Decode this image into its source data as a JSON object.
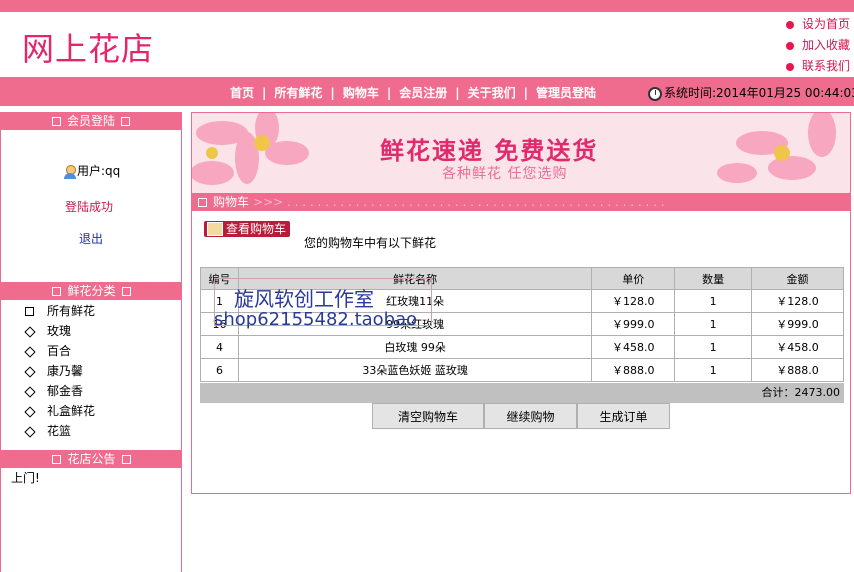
{
  "site": {
    "brand": "网上花店"
  },
  "top_links": [
    {
      "label": "设为首页"
    },
    {
      "label": "加入收藏"
    },
    {
      "label": "联系我们"
    }
  ],
  "nav": {
    "items": [
      {
        "label": "首页"
      },
      {
        "label": "所有鲜花"
      },
      {
        "label": "购物车"
      },
      {
        "label": "会员注册"
      },
      {
        "label": "关于我们"
      },
      {
        "label": "管理员登陆"
      }
    ],
    "systime": "系统时间:2014年01月25 00:44:03"
  },
  "sidebar": {
    "login_header": "会员登陆",
    "user_label": "用户:qq",
    "login_status": "登陆成功",
    "logout_label": "退出",
    "category_header": "鲜花分类",
    "categories": [
      {
        "label": "所有鲜花"
      },
      {
        "label": "玫瑰"
      },
      {
        "label": "百合"
      },
      {
        "label": "康乃馨"
      },
      {
        "label": "郁金香"
      },
      {
        "label": "礼盒鲜花"
      },
      {
        "label": "花篮"
      }
    ],
    "notice_header": "花店公告",
    "notice_text": "上门!"
  },
  "banner": {
    "title": "鲜花速递 免费送货",
    "subtitle": "各种鲜花 任您选购"
  },
  "cart": {
    "header": "购物车",
    "view_cart_label": "查看购物车",
    "message": "您的购物车中有以下鲜花",
    "columns": [
      "编号",
      "鲜花名称",
      "单价",
      "数量",
      "金额"
    ],
    "rows": [
      {
        "id": "1",
        "name": "红玫瑰11朵",
        "price": "￥128.0",
        "qty": "1",
        "amount": "￥128.0"
      },
      {
        "id": "16",
        "name": "99朵红玫瑰",
        "price": "￥999.0",
        "qty": "1",
        "amount": "￥999.0"
      },
      {
        "id": "4",
        "name": "白玫瑰 99朵",
        "price": "￥458.0",
        "qty": "1",
        "amount": "￥458.0"
      },
      {
        "id": "6",
        "name": "33朵蓝色妖姬 蓝玫瑰",
        "price": "￥888.0",
        "qty": "1",
        "amount": "￥888.0"
      }
    ],
    "total": "合计：2473.00",
    "buttons": {
      "clear": "清空购物车",
      "continue": "继续购物",
      "order": "生成订单"
    }
  },
  "watermark": {
    "line1": "旋风软创工作室",
    "line2": "shop62155482.taobao"
  },
  "colors": {
    "accent": "#f06c8e",
    "brand": "#e6246a"
  }
}
